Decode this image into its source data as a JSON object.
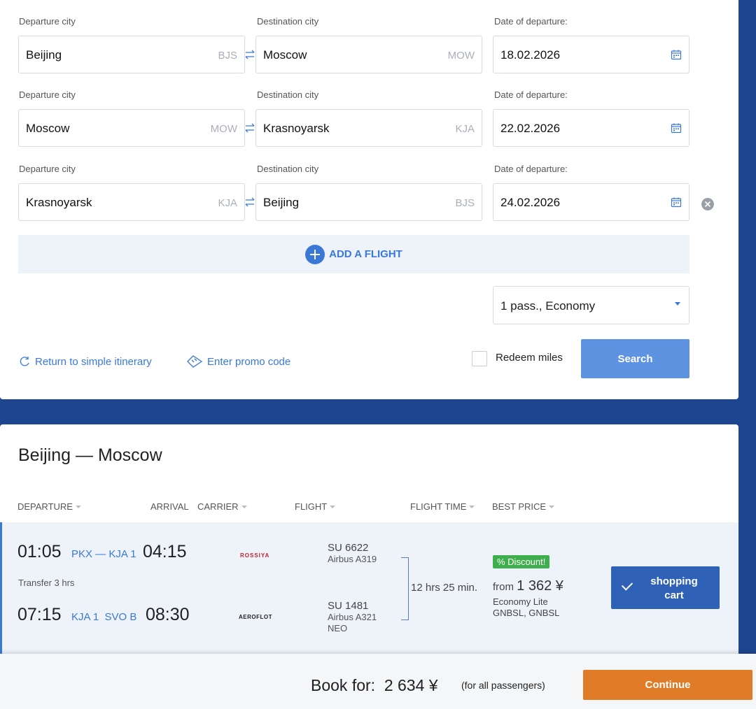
{
  "search_form": {
    "segments": [
      {
        "departure_label": "Departure city",
        "departure_city": "Beijing",
        "departure_code": "BJS",
        "destination_label": "Destination city",
        "destination_city": "Moscow",
        "destination_code": "MOW",
        "date_label": "Date of departure:",
        "date": "18.02.2026"
      },
      {
        "departure_label": "Departure city",
        "departure_city": "Moscow",
        "departure_code": "MOW",
        "destination_label": "Destination city",
        "destination_city": "Krasnoyarsk",
        "destination_code": "KJA",
        "date_label": "Date of departure:",
        "date": "22.02.2026"
      },
      {
        "departure_label": "Departure city",
        "departure_city": "Krasnoyarsk",
        "departure_code": "KJA",
        "destination_label": "Destination city",
        "destination_city": "Beijing",
        "destination_code": "BJS",
        "date_label": "Date of departure:",
        "date": "24.02.2026"
      }
    ],
    "add_flight_label": "ADD A FLIGHT",
    "passengers_value": "1 pass., Economy",
    "return_link": "Return to simple itinerary",
    "promo_link": "Enter promo code",
    "redeem_label": "Redeem miles",
    "search_label": "Search"
  },
  "results": {
    "route_title": "Beijing — Moscow",
    "columns": {
      "departure": "DEPARTURE",
      "arrival": "ARRIVAL",
      "carrier": "CARRIER",
      "flight": "FLIGHT",
      "flight_time": "FLIGHT TIME",
      "best_price": "BEST PRICE"
    },
    "option": {
      "leg1": {
        "dep_time": "01:05",
        "route": "PKX — KJA 1",
        "arr_time": "04:15",
        "carrier_logo": "ROSSIYA",
        "flight_no": "SU 6622",
        "aircraft": "Airbus A319"
      },
      "transfer": "Transfer 3 hrs",
      "leg2": {
        "dep_time": "07:15",
        "route": "KJA 1  SVO B",
        "arr_time": "08:30",
        "carrier_logo": "AEROFLOT",
        "flight_no": "SU 1481",
        "aircraft": "Airbus A321",
        "aircraft2": "NEO"
      },
      "duration": "12 hrs 25 min.",
      "discount": "% Discount!",
      "price_from": "from",
      "price_amount": "1 362 ¥",
      "fare_class": "Economy Lite",
      "fare_codes": "GNBSL, GNBSL",
      "cart_label_line1": "shopping",
      "cart_label_line2": "cart"
    }
  },
  "footer": {
    "book_label": "Book for:  2 634 ¥",
    "note": "(for all passengers)",
    "continue_label": "Continue"
  },
  "colors": {
    "accent": "#3a78d8",
    "background": "#1d4590",
    "continue": "#e07c27",
    "discount": "#3fae4c"
  }
}
